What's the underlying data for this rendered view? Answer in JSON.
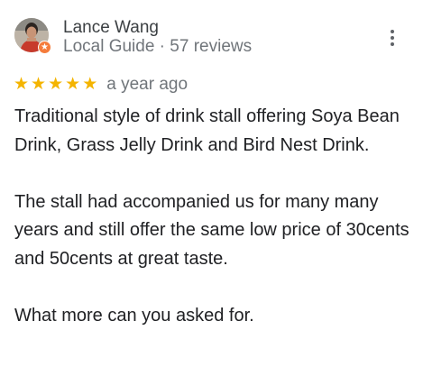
{
  "review": {
    "author": "Lance Wang",
    "author_meta": "Local Guide · 57 reviews",
    "rating": 5,
    "max_rating": 5,
    "star_glyph": "★",
    "time": "a year ago",
    "paragraphs": [
      "Traditional style of drink stall offering Soya Bean Drink, Grass Jelly Drink and Bird Nest Drink.",
      "The stall had accompanied us for many many years and still offer the same low price of 30cents and 50cents at great taste.",
      "What more can you asked for."
    ]
  },
  "icons": {
    "avatar": "profile-photo",
    "badge": "local-guide-star-badge",
    "menu": "more-vert-icon"
  },
  "colors": {
    "star": "#f4b400",
    "badge": "#f57c3c",
    "name": "#3c4043",
    "meta": "#70757a",
    "body": "#202124"
  }
}
